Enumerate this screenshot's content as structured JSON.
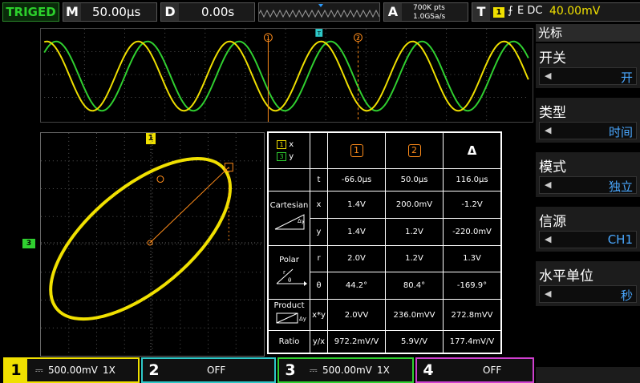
{
  "status": {
    "trigger_state": "TRIGED"
  },
  "timebase": {
    "key": "M",
    "value": "50.00μs"
  },
  "delay": {
    "key": "D",
    "value": "0.00s"
  },
  "acquire": {
    "key": "A",
    "points": "700K pts",
    "rate": "1.0GSa/s"
  },
  "trigger": {
    "key": "T",
    "channel": "1",
    "slope": "⨍",
    "type": "E DC",
    "level": "40.00mV"
  },
  "cursors": {
    "c1": "1",
    "c2": "2",
    "trig_marker": "T"
  },
  "ch_markers": {
    "c1": "1",
    "c3": "3"
  },
  "menu": {
    "title": "光标",
    "items": [
      {
        "label": "开关",
        "value": "开"
      },
      {
        "label": "类型",
        "value": "时间"
      },
      {
        "label": "模式",
        "value": "独立"
      },
      {
        "label": "信源",
        "value": "CH1"
      },
      {
        "label": "水平单位",
        "value": "秒"
      }
    ]
  },
  "table": {
    "hdr_x_ch": "1",
    "hdr_x": "x",
    "hdr_y_ch": "3",
    "hdr_y": "y",
    "col1": "1",
    "col2": "2",
    "col3": "Δ",
    "t": {
      "label": "t",
      "c1": "-66.0μs",
      "c2": "50.0μs",
      "d": "116.0μs"
    },
    "cart_label": "Cartesian",
    "x": {
      "label": "x",
      "c1": "1.4V",
      "c2": "200.0mV",
      "d": "-1.2V"
    },
    "y": {
      "label": "y",
      "c1": "1.4V",
      "c2": "1.2V",
      "d": "-220.0mV"
    },
    "polar_label": "Polar",
    "r": {
      "label": "r",
      "c1": "2.0V",
      "c2": "1.2V",
      "d": "1.3V"
    },
    "th": {
      "label": "θ",
      "c1": "44.2°",
      "c2": "80.4°",
      "d": "-169.9°"
    },
    "product_label": "Product",
    "xy": {
      "label": "x*y",
      "c1": "2.0VV",
      "c2": "236.0mVV",
      "d": "272.8mVV"
    },
    "ratio_label": "Ratio",
    "yx": {
      "label": "y/x",
      "c1": "972.2mV/V",
      "c2": "5.9V/V",
      "d": "177.4mV/V"
    }
  },
  "channels": [
    {
      "num": "1",
      "scale": "500.00mV",
      "coupling": "1X",
      "color": "#f0e000"
    },
    {
      "num": "2",
      "state": "OFF",
      "color": "#2ec8c8"
    },
    {
      "num": "3",
      "scale": "500.00mV",
      "coupling": "1X",
      "color": "#30d030"
    },
    {
      "num": "4",
      "state": "OFF",
      "color": "#d040d0"
    }
  ]
}
